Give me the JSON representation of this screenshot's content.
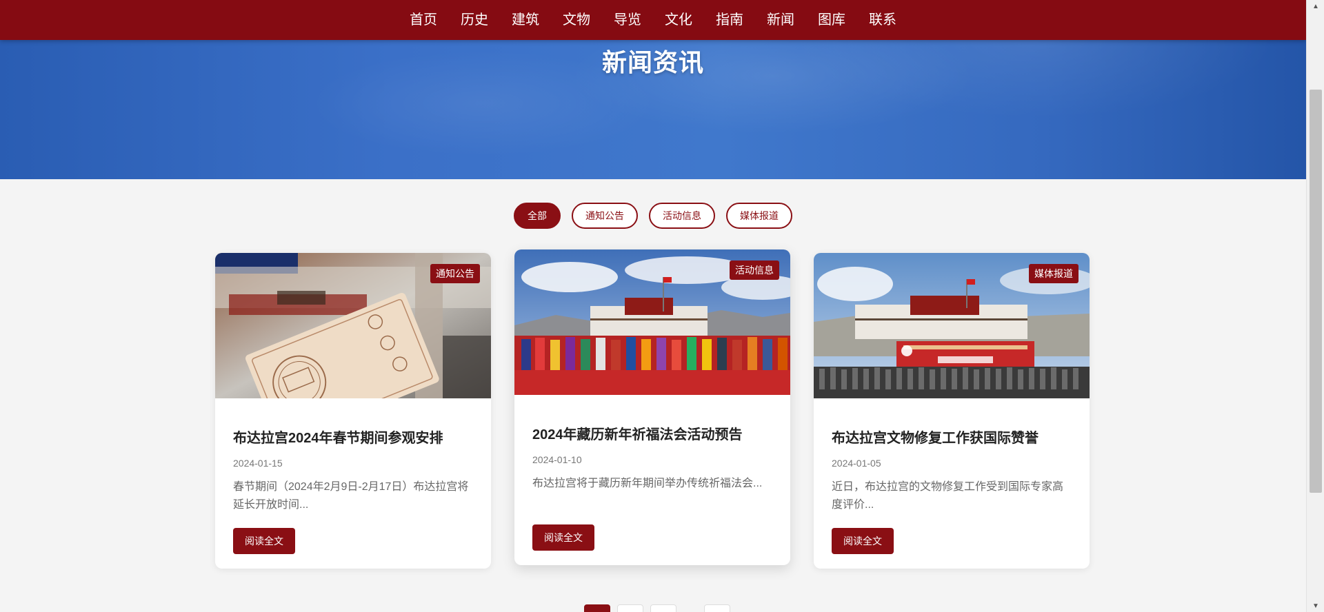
{
  "nav": {
    "items": [
      {
        "label": "首页"
      },
      {
        "label": "历史"
      },
      {
        "label": "建筑"
      },
      {
        "label": "文物"
      },
      {
        "label": "导览"
      },
      {
        "label": "文化"
      },
      {
        "label": "指南"
      },
      {
        "label": "新闻"
      },
      {
        "label": "图库"
      },
      {
        "label": "联系"
      }
    ]
  },
  "hero": {
    "title": "新闻资讯"
  },
  "filters": [
    {
      "label": "全部",
      "active": true
    },
    {
      "label": "通知公告",
      "active": false
    },
    {
      "label": "活动信息",
      "active": false
    },
    {
      "label": "媒体报道",
      "active": false
    }
  ],
  "cards": [
    {
      "tag": "通知公告",
      "title": "布达拉宫2024年春节期间参观安排",
      "date": "2024-01-15",
      "excerpt": "春节期间（2024年2月9日-2月17日）布达拉宫将延长开放时间...",
      "button": "阅读全文"
    },
    {
      "tag": "活动信息",
      "title": "2024年藏历新年祈福法会活动预告",
      "date": "2024-01-10",
      "excerpt": "布达拉宫将于藏历新年期间举办传统祈福法会...",
      "button": "阅读全文"
    },
    {
      "tag": "媒体报道",
      "title": "布达拉宫文物修复工作获国际赞誉",
      "date": "2024-01-05",
      "excerpt": "近日，布达拉宫的文物修复工作受到国际专家高度评价...",
      "button": "阅读全文"
    }
  ],
  "colors": {
    "brand": "#850b12",
    "accent": "#8a0f14",
    "hero_blue": "#3b70c8",
    "page_bg": "#f4f4f4"
  }
}
